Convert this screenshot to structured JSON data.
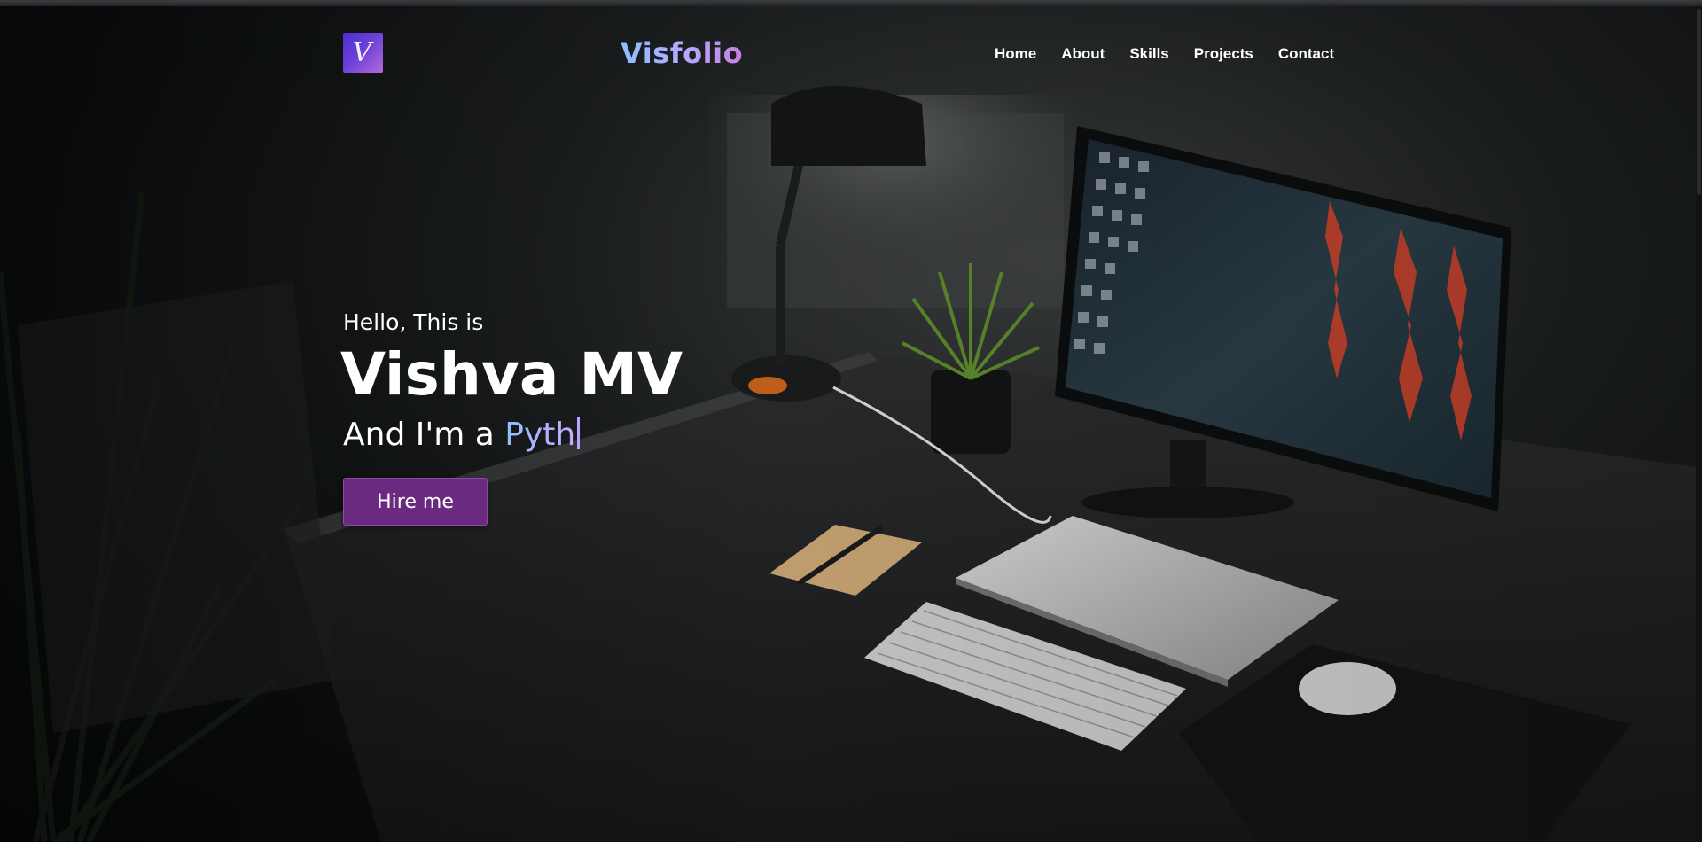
{
  "header": {
    "logo_letter": "V",
    "brand": "Visfolio",
    "nav": [
      {
        "label": "Home"
      },
      {
        "label": "About"
      },
      {
        "label": "Skills"
      },
      {
        "label": "Projects"
      },
      {
        "label": "Contact"
      }
    ]
  },
  "hero": {
    "greeting": "Hello, This is",
    "name": "Vishva MV",
    "role_prefix": "And I'm a ",
    "role_typed": "Pyth",
    "cta_label": "Hire me"
  },
  "colors": {
    "accent_button": "#6a2a80",
    "brand_gradient_start": "#8ec0ff",
    "brand_gradient_end": "#c97de6",
    "page_background": "#0b0d0e"
  },
  "icons": {
    "logo": "v-monogram-logo"
  }
}
